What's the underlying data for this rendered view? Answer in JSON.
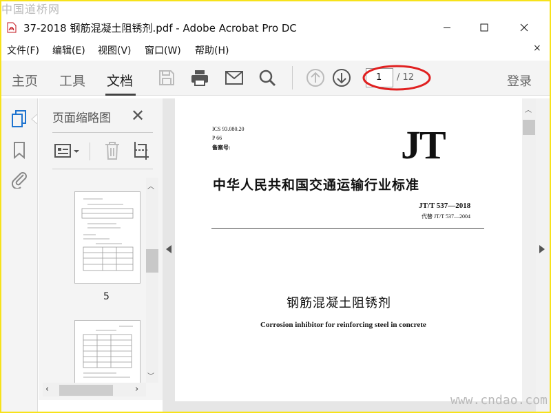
{
  "watermark_top": "中国道桥网",
  "watermark_bottom": "www.cndao.com",
  "window": {
    "title": "37-2018 钢筋混凝土阻锈剂.pdf - Adobe Acrobat Pro DC",
    "minimize_icon": "minimize-icon",
    "maximize_icon": "maximize-icon",
    "close_icon": "close-icon"
  },
  "menu": {
    "items": [
      "文件(F)",
      "编辑(E)",
      "视图(V)",
      "窗口(W)",
      "帮助(H)"
    ],
    "close_glyph": "×"
  },
  "toolbar": {
    "tabs": [
      "主页",
      "工具",
      "文档"
    ],
    "active_tab": "文档",
    "tools": [
      "save-icon",
      "print-icon",
      "mail-icon",
      "search-icon",
      "arrow-up-icon",
      "arrow-down-icon"
    ],
    "page_current": "1",
    "page_total": "/ 12",
    "login": "登录",
    "highlight_color": "#e02020"
  },
  "leftnav": {
    "icons": [
      "pages-icon",
      "bookmark-icon",
      "attachment-icon"
    ],
    "accent": "#1e74d0"
  },
  "thumbnails": {
    "title": "页面缩略图",
    "close_glyph": "✕",
    "tools": [
      "thumbnail-options-icon",
      "delete-icon",
      "crop-icon"
    ],
    "visible_page_label": "5"
  },
  "document": {
    "ics": "ICS 93.080.20",
    "p_number": "P 66",
    "filing": "备案号:",
    "logo": "JT",
    "standard_title": "中华人民共和国交通运输行业标准",
    "code": "JT/T 537—2018",
    "replaces": "代替 JT/T 537—2004",
    "title_cn": "钢筋混凝土阻锈剂",
    "title_en": "Corrosion inhibitor for reinforcing steel in concrete"
  }
}
